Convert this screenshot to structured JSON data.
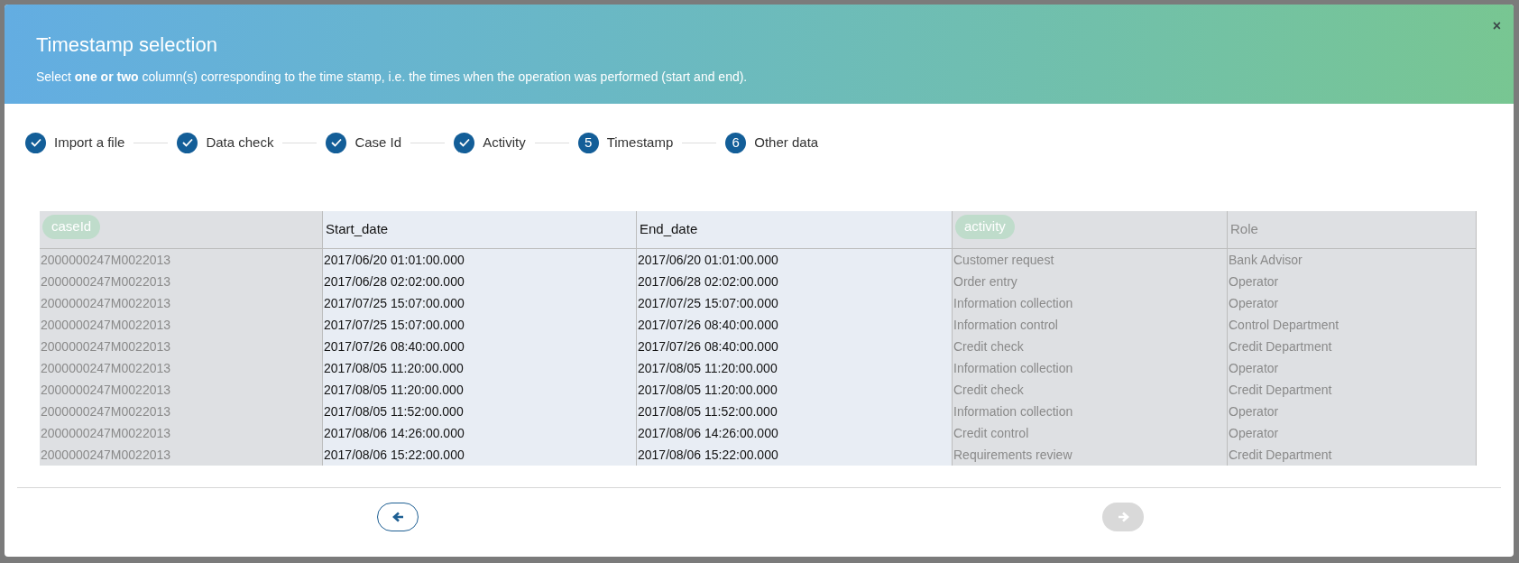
{
  "dialog": {
    "title": "Timestamp selection",
    "subtitle": "Select **one or two** column(s) corresponding to the time stamp, i.e. the times when the operation was performed (start and end).",
    "close": "×"
  },
  "steps": [
    {
      "label": "Import a file",
      "done": true
    },
    {
      "label": "Data check",
      "done": true
    },
    {
      "label": "Case Id",
      "done": true
    },
    {
      "label": "Activity",
      "done": true
    },
    {
      "label": "Timestamp",
      "done": false,
      "number": "5"
    },
    {
      "label": "Other data",
      "done": false,
      "number": "6"
    }
  ],
  "table": {
    "columns": [
      {
        "tag": "caseId",
        "selected": false
      },
      {
        "label": "Start_date",
        "selected": true
      },
      {
        "label": "End_date",
        "selected": true
      },
      {
        "tag": "activity",
        "selected": false
      },
      {
        "label": "Role",
        "selected": false
      }
    ],
    "rows": [
      [
        "2000000247M0022013",
        "2017/06/20 01:01:00.000",
        "2017/06/20 01:01:00.000",
        "Customer request",
        "Bank Advisor"
      ],
      [
        "2000000247M0022013",
        "2017/06/28 02:02:00.000",
        "2017/06/28 02:02:00.000",
        "Order entry",
        "Operator"
      ],
      [
        "2000000247M0022013",
        "2017/07/25 15:07:00.000",
        "2017/07/25 15:07:00.000",
        "Information collection",
        "Operator"
      ],
      [
        "2000000247M0022013",
        "2017/07/25 15:07:00.000",
        "2017/07/26 08:40:00.000",
        "Information control",
        "Control Department"
      ],
      [
        "2000000247M0022013",
        "2017/07/26 08:40:00.000",
        "2017/07/26 08:40:00.000",
        "Credit check",
        "Credit Department"
      ],
      [
        "2000000247M0022013",
        "2017/08/05 11:20:00.000",
        "2017/08/05 11:20:00.000",
        "Information collection",
        "Operator"
      ],
      [
        "2000000247M0022013",
        "2017/08/05 11:20:00.000",
        "2017/08/05 11:20:00.000",
        "Credit check",
        "Credit Department"
      ],
      [
        "2000000247M0022013",
        "2017/08/05 11:52:00.000",
        "2017/08/05 11:52:00.000",
        "Information collection",
        "Operator"
      ],
      [
        "2000000247M0022013",
        "2017/08/06 14:26:00.000",
        "2017/08/06 14:26:00.000",
        "Credit control",
        "Operator"
      ],
      [
        "2000000247M0022013",
        "2017/08/06 15:22:00.000",
        "2017/08/06 15:22:00.000",
        "Requirements review",
        "Credit Department"
      ]
    ]
  },
  "nav": {
    "back": {
      "disabled": false
    },
    "next": {
      "disabled": true
    }
  }
}
